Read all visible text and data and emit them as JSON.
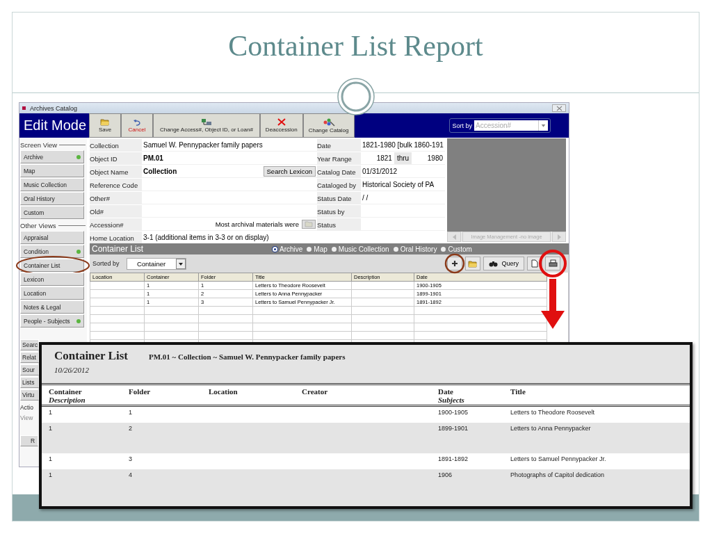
{
  "slide": {
    "title": "Container List Report"
  },
  "window": {
    "title": "Archives Catalog"
  },
  "mode": "Edit Mode",
  "toolbar": [
    {
      "kind": "save",
      "label": "Save"
    },
    {
      "kind": "cancel",
      "label": "Cancel"
    },
    {
      "kind": "change-id",
      "label": "Change Access#, Object ID, or Loan#"
    },
    {
      "kind": "deaccession",
      "label": "Deaccession"
    },
    {
      "kind": "change-catalog",
      "label": "Change Catalog"
    }
  ],
  "sort": {
    "label": "Sort by",
    "placeholder": "Accession#"
  },
  "sidebar": {
    "sections": [
      {
        "heading": "Screen View",
        "items": [
          {
            "label": "Archive",
            "indicator": true
          },
          {
            "label": "Map",
            "indicator": false
          },
          {
            "label": "Music Collection",
            "indicator": false
          },
          {
            "label": "Oral History",
            "indicator": false
          },
          {
            "label": "Custom",
            "indicator": false
          }
        ]
      },
      {
        "heading": "Other Views",
        "items": [
          {
            "label": "Appraisal",
            "indicator": false
          },
          {
            "label": "Condition",
            "indicator": true
          },
          {
            "label": "Container List",
            "indicator": false,
            "circled": true
          },
          {
            "label": "Lexicon",
            "indicator": false
          },
          {
            "label": "Location",
            "indicator": false
          },
          {
            "label": "Notes & Legal",
            "indicator": false
          },
          {
            "label": "People - Subjects",
            "indicator": true
          }
        ]
      }
    ],
    "covered_items": [
      "Searc",
      "Relat",
      "Sour",
      "Lists",
      "Virtu"
    ],
    "actions_heading": "Actio",
    "actions_link": "View",
    "covered_button": "R"
  },
  "form": {
    "left": [
      {
        "label": "Collection",
        "value": "Samuel W. Pennypacker family papers"
      },
      {
        "label": "Object ID",
        "value": "PM.01",
        "bold": true
      },
      {
        "label": "Object Name",
        "value": "Collection",
        "bold": true,
        "button": "Search Lexicon"
      },
      {
        "label": "Reference Code"
      },
      {
        "label": "Other#"
      },
      {
        "label": "Old#"
      },
      {
        "label": "Accession#",
        "note": "Most archival materials were"
      },
      {
        "label": "Home Location",
        "value": "3-1 (additional items in 3-3 or on display)"
      }
    ],
    "right": [
      {
        "label": "Date",
        "value": "1821-1980 [bulk 1860-191"
      },
      {
        "label": "Year Range",
        "value": "1821",
        "thru": "thru",
        "value_end": "1980"
      },
      {
        "label": "Catalog Date",
        "value": "01/31/2012"
      },
      {
        "label": "Cataloged by",
        "value": "Historical Society of PA"
      },
      {
        "label": "Status Date",
        "value": "/ /"
      },
      {
        "label": "Status by"
      },
      {
        "label": "Status"
      }
    ]
  },
  "image_panel": {
    "caption": "Image Management -no image"
  },
  "container_list": {
    "title": "Container List",
    "views": [
      {
        "label": "Archive",
        "selected": true
      },
      {
        "label": "Map",
        "selected": false
      },
      {
        "label": "Music Collection",
        "selected": false
      },
      {
        "label": "Oral History",
        "selected": false
      },
      {
        "label": "Custom",
        "selected": false
      }
    ],
    "sorted_label": "Sorted by",
    "sorted_value": "Container",
    "query_label": "Query",
    "columns": [
      "Location",
      "Container",
      "Folder",
      "Title",
      "Description",
      "Date"
    ],
    "rows": [
      {
        "container": "1",
        "folder": "1",
        "title": "Letters to Theodore Roosevelt",
        "date": "1900-1905"
      },
      {
        "container": "1",
        "folder": "2",
        "title": "Letters to Anna Pennypacker",
        "date": "1899-1901"
      },
      {
        "container": "1",
        "folder": "3",
        "title": "Letters to Samuel Pennypacker Jr.",
        "date": "1891-1892"
      }
    ]
  },
  "report": {
    "title": "Container List",
    "subtitle": "PM.01 ~ Collection ~ Samuel W. Pennypacker family papers",
    "date": "10/26/2012",
    "columns": [
      {
        "main": "Container",
        "sub": "Description"
      },
      {
        "main": "Folder"
      },
      {
        "main": "Location"
      },
      {
        "main": "Creator"
      },
      {
        "main": "Date",
        "sub": "Subjects"
      },
      {
        "main": "Title"
      }
    ],
    "rows": [
      {
        "container": "1",
        "folder": "1",
        "date": "1900-1905",
        "title": "Letters to Theodore Roosevelt"
      },
      {
        "container": "1",
        "folder": "2",
        "date": "1899-1901",
        "title": "Letters to Anna Pennypacker"
      },
      {
        "container": "1",
        "folder": "3",
        "date": "1891-1892",
        "title": "Letters to Samuel Pennypacker Jr."
      },
      {
        "container": "1",
        "folder": "4",
        "date": "1906",
        "title": "Photographs of Capitol dedication"
      }
    ]
  }
}
